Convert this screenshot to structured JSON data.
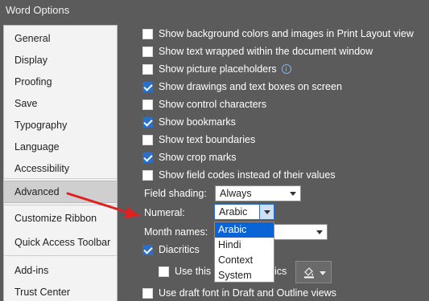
{
  "window": {
    "title": "Word Options"
  },
  "sidebar": {
    "items": [
      {
        "label": "General"
      },
      {
        "label": "Display"
      },
      {
        "label": "Proofing"
      },
      {
        "label": "Save"
      },
      {
        "label": "Typography"
      },
      {
        "label": "Language"
      },
      {
        "label": "Accessibility"
      },
      {
        "label": "Advanced",
        "selected": true
      },
      {
        "label": "Customize Ribbon"
      },
      {
        "label": "Quick Access Toolbar"
      },
      {
        "label": "Add-ins"
      },
      {
        "label": "Trust Center"
      }
    ]
  },
  "options": [
    {
      "label": "Show background colors and images in Print Layout view",
      "checked": false
    },
    {
      "label": "Show text wrapped within the document window",
      "checked": false
    },
    {
      "label": "Show picture placeholders",
      "checked": false
    },
    {
      "label": "Show drawings and text boxes on screen",
      "checked": true
    },
    {
      "label": "Show control characters",
      "checked": false
    },
    {
      "label": "Show bookmarks",
      "checked": true
    },
    {
      "label": "Show text boundaries",
      "checked": false
    },
    {
      "label": "Show crop marks",
      "checked": true
    },
    {
      "label": "Show field codes instead of their values",
      "checked": false
    }
  ],
  "field_shading": {
    "label": "Field shading:",
    "value": "Always"
  },
  "numeral": {
    "label": "Numeral:",
    "value": "Arabic",
    "options": [
      "Arabic",
      "Hindi",
      "Context",
      "System"
    ],
    "highlighted": "Arabic"
  },
  "month_names": {
    "label": "Month names:"
  },
  "diacritics": {
    "label": "Diacritics",
    "checked": true
  },
  "use_this_color": {
    "label_start": "Use this c",
    "label_end": "ics",
    "checked": false
  },
  "draft_font": {
    "label": "Use draft font in Draft and Outline views",
    "checked": false
  },
  "colors": {
    "accent": "#2b6fc7",
    "highlight": "#0a64d6",
    "arrow": "#e02020"
  }
}
